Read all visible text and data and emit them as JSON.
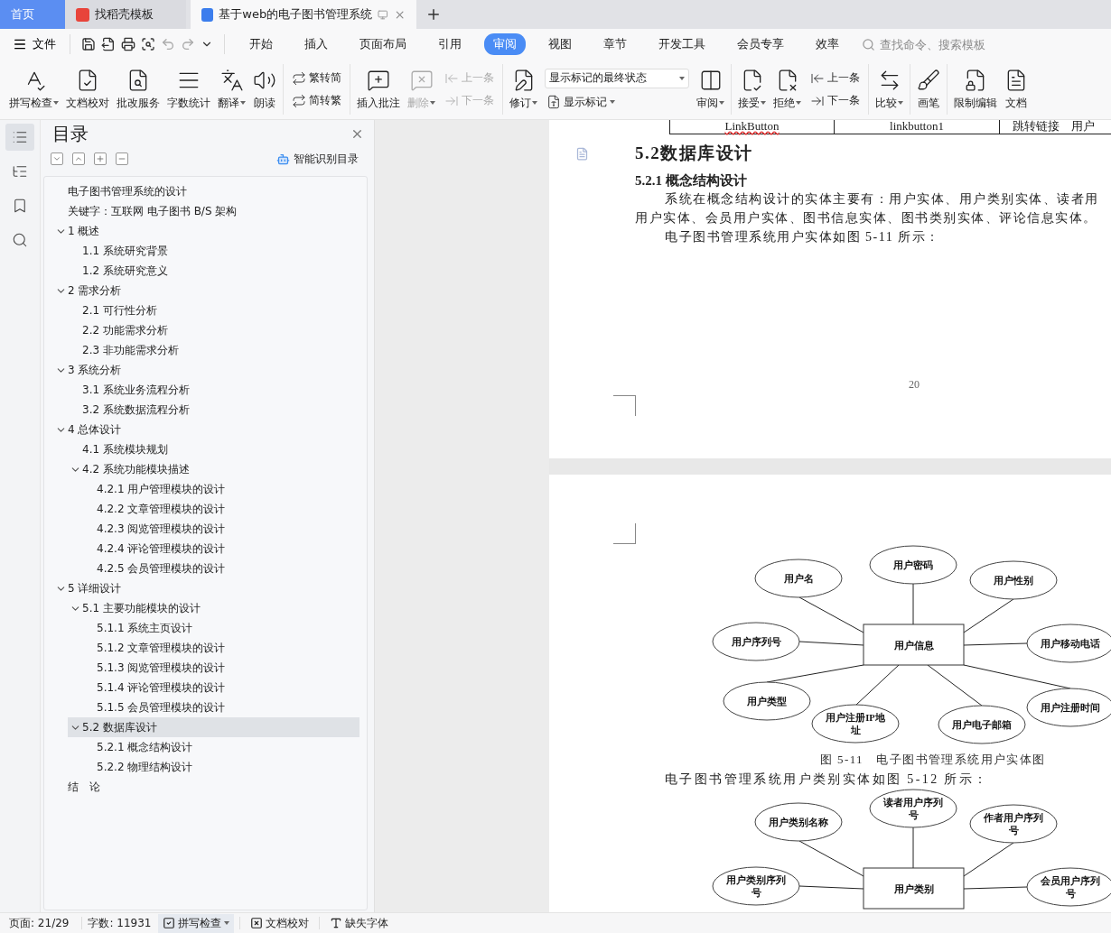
{
  "tabs": [
    {
      "kind": "home",
      "label": "首页",
      "selected": false
    },
    {
      "kind": "template",
      "label": "找稻壳模板",
      "selected": false
    },
    {
      "kind": "document",
      "label": "基于web的电子图书管理系统",
      "selected": true
    }
  ],
  "menu": {
    "file": "文件",
    "tabs": [
      {
        "label": "开始",
        "selected": false
      },
      {
        "label": "插入",
        "selected": false
      },
      {
        "label": "页面布局",
        "selected": false
      },
      {
        "label": "引用",
        "selected": false
      },
      {
        "label": "审阅",
        "selected": true
      },
      {
        "label": "视图",
        "selected": false
      },
      {
        "label": "章节",
        "selected": false
      },
      {
        "label": "开发工具",
        "selected": false
      },
      {
        "label": "会员专享",
        "selected": false
      },
      {
        "label": "效率",
        "selected": false
      }
    ],
    "search_placeholder": "查找命令、搜索模板"
  },
  "ribbon": [
    {
      "kind": "large",
      "label": "拼写检查",
      "dropdown": true,
      "disabled": false
    },
    {
      "kind": "large",
      "label": "文档校对",
      "dropdown": false,
      "disabled": false
    },
    {
      "kind": "large",
      "label": "批改服务",
      "dropdown": false,
      "disabled": false
    },
    {
      "kind": "large",
      "label": "字数统计",
      "dropdown": false,
      "disabled": false
    },
    {
      "kind": "large",
      "label": "翻译",
      "dropdown": true,
      "disabled": false
    },
    {
      "kind": "large",
      "label": "朗读",
      "dropdown": false,
      "disabled": false
    },
    {
      "kind": "separator"
    },
    {
      "kind": "stack",
      "items": [
        {
          "label": "繁转简",
          "disabled": false
        },
        {
          "label": "简转繁",
          "disabled": false
        }
      ]
    },
    {
      "kind": "separator"
    },
    {
      "kind": "large",
      "label": "插入批注",
      "dropdown": false,
      "disabled": false
    },
    {
      "kind": "large",
      "label": "删除",
      "dropdown": true,
      "disabled": true
    },
    {
      "kind": "stack",
      "items": [
        {
          "label": "上一条",
          "disabled": true
        },
        {
          "label": "下一条",
          "disabled": true
        }
      ]
    },
    {
      "kind": "separator"
    },
    {
      "kind": "large",
      "label": "修订",
      "dropdown": true,
      "disabled": false
    },
    {
      "kind": "display",
      "select": "显示标记的最终状态",
      "button": "显示标记"
    },
    {
      "kind": "large",
      "label": "审阅",
      "dropdown": true,
      "disabled": false
    },
    {
      "kind": "separator"
    },
    {
      "kind": "large",
      "label": "接受",
      "dropdown": true,
      "disabled": false
    },
    {
      "kind": "large",
      "label": "拒绝",
      "dropdown": true,
      "disabled": false
    },
    {
      "kind": "stack",
      "items": [
        {
          "label": "上一条",
          "disabled": false
        },
        {
          "label": "下一条",
          "disabled": false
        }
      ]
    },
    {
      "kind": "separator"
    },
    {
      "kind": "large",
      "label": "比较",
      "dropdown": true,
      "disabled": false
    },
    {
      "kind": "separator"
    },
    {
      "kind": "large",
      "label": "画笔",
      "dropdown": false,
      "disabled": false
    },
    {
      "kind": "separator"
    },
    {
      "kind": "large",
      "label": "限制编辑",
      "dropdown": false,
      "disabled": false
    },
    {
      "kind": "large",
      "label": "文档",
      "dropdown": false,
      "disabled": false
    }
  ],
  "rail": [
    {
      "selected": true
    },
    {
      "selected": false
    },
    {
      "selected": false
    },
    {
      "selected": false
    }
  ],
  "toc": {
    "title": "目录",
    "smart_button": "智能识别目录",
    "items": [
      {
        "label": "电子图书管理系统的设计",
        "selected": false
      },
      {
        "label": "关键字：互联网 电子图书 B/S 架构",
        "selected": false
      },
      {
        "label": "1 概述",
        "selected": false,
        "expanded": true,
        "children": [
          {
            "label": "1.1 系统研究背景",
            "selected": false
          },
          {
            "label": "1.2 系统研究意义",
            "selected": false
          }
        ]
      },
      {
        "label": "2 需求分析",
        "selected": false,
        "expanded": true,
        "children": [
          {
            "label": "2.1 可行性分析",
            "selected": false
          },
          {
            "label": "2.2 功能需求分析",
            "selected": false
          },
          {
            "label": "2.3 非功能需求分析",
            "selected": false
          }
        ]
      },
      {
        "label": "3 系统分析",
        "selected": false,
        "expanded": true,
        "children": [
          {
            "label": "3.1 系统业务流程分析",
            "selected": false
          },
          {
            "label": "3.2 系统数据流程分析",
            "selected": false
          }
        ]
      },
      {
        "label": "4 总体设计",
        "selected": false,
        "expanded": true,
        "children": [
          {
            "label": "4.1 系统模块规划",
            "selected": false
          },
          {
            "label": "4.2 系统功能模块描述",
            "selected": false,
            "expanded": true,
            "children": [
              {
                "label": "4.2.1 用户管理模块的设计",
                "selected": false
              },
              {
                "label": "4.2.2 文章管理模块的设计",
                "selected": false
              },
              {
                "label": "4.2.3 阅览管理模块的设计",
                "selected": false
              },
              {
                "label": "4.2.4 评论管理模块的设计",
                "selected": false
              },
              {
                "label": "4.2.5 会员管理模块的设计",
                "selected": false
              }
            ]
          }
        ]
      },
      {
        "label": "5 详细设计",
        "selected": false,
        "expanded": true,
        "children": [
          {
            "label": "5.1 主要功能模块的设计",
            "selected": false,
            "expanded": true,
            "children": [
              {
                "label": "5.1.1 系统主页设计",
                "selected": false
              },
              {
                "label": "5.1.2 文章管理模块的设计",
                "selected": false
              },
              {
                "label": "5.1.3 阅览管理模块的设计",
                "selected": false
              },
              {
                "label": "5.1.4 评论管理模块的设计",
                "selected": false
              },
              {
                "label": "5.1.5 会员管理模块的设计",
                "selected": false
              }
            ]
          },
          {
            "label": "5.2 数据库设计",
            "selected": true,
            "expanded": true,
            "children": [
              {
                "label": "5.2.1 概念结构设计",
                "selected": false
              },
              {
                "label": "5.2.2 物理结构设计",
                "selected": false
              }
            ]
          }
        ]
      },
      {
        "label": "结　论",
        "selected": false
      }
    ]
  },
  "document": {
    "table_row": [
      {
        "text": "LinkButton",
        "misspelled": true
      },
      {
        "text": "linkbutton1",
        "misspelled": false
      },
      {
        "text": "跳转链接　用户",
        "misspelled": false
      }
    ],
    "heading": "5.2数据库设计",
    "subheading": "5.2.1 概念结构设计",
    "paragraph_lines": [
      "系统在概念结构设计的实体主要有：用户实体、用户类别实体、读者用",
      "用户实体、会员用户实体、图书信息实体、图书类别实体、评论信息实体。"
    ],
    "intro": "电子图书管理系统用户实体如图 5-11 所示：",
    "page_number": "20",
    "figure_1": {
      "entity": "用户信息",
      "attributes": [
        {
          "lines": [
            "用户名"
          ]
        },
        {
          "lines": [
            "用户密码"
          ]
        },
        {
          "lines": [
            "用户性别"
          ]
        },
        {
          "lines": [
            "用户序列号"
          ]
        },
        {
          "lines": [
            "用户移动电话"
          ]
        },
        {
          "lines": [
            "用户类型"
          ]
        },
        {
          "lines": [
            "用户注册IP地",
            "址"
          ]
        },
        {
          "lines": [
            "用户电子邮箱"
          ]
        },
        {
          "lines": [
            "用户注册时间"
          ]
        }
      ]
    },
    "caption": "图 5-11　电子图书管理系统用户实体图",
    "intro_2": "电子图书管理系统用户类别实体如图 5-12 所示：",
    "figure_2": {
      "entity": "用户类别",
      "attributes": [
        {
          "lines": [
            "用户类别名称"
          ]
        },
        {
          "lines": [
            "读者用户序列",
            "号"
          ]
        },
        {
          "lines": [
            "作者用户序列",
            "号"
          ]
        },
        {
          "lines": [
            "用户类别序列",
            "号"
          ]
        },
        {
          "lines": [
            "会员用户序列",
            "号"
          ]
        }
      ]
    }
  },
  "status": {
    "page": "页面: 21/29",
    "words": "字数: 11931",
    "spell": "拼写检查",
    "proof": "文档校对",
    "fonts": "缺失字体"
  }
}
